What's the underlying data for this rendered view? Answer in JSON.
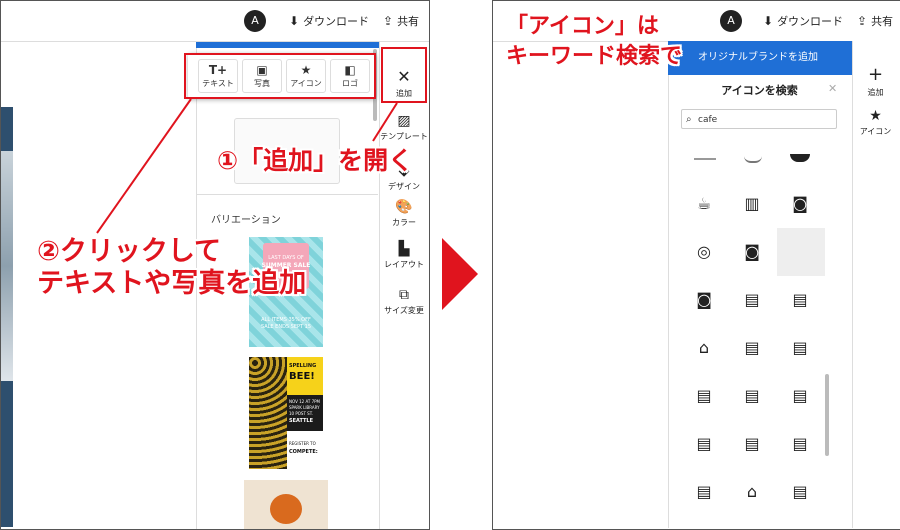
{
  "left": {
    "header": {
      "avatar_initial": "A",
      "download_label": "ダウンロード",
      "share_label": "共有"
    },
    "toolbar_popup": {
      "items": [
        {
          "icon": "T+",
          "label": "テキスト"
        },
        {
          "icon": "▣",
          "label": "写真"
        },
        {
          "icon": "★",
          "label": "アイコン"
        },
        {
          "icon": "◧",
          "label": "ロゴ"
        }
      ]
    },
    "rail": {
      "add_label": "追加",
      "template_label": "テンプレート",
      "design_label": "デザイン",
      "color_label": "カラー",
      "layout_label": "レイアウト",
      "resize_label": "サイズ変更"
    },
    "panel": {
      "section_title": "バリエーション"
    },
    "thumb1": {
      "line1": "LAST DAYS OF",
      "line2": "SUMMER SALE",
      "line3": "ALL ITEMS 35% OFF",
      "line4": "SALE ENDS SEPT 15"
    },
    "thumb2": {
      "line1": "SPELLING",
      "line2": "BEE!",
      "line3": "NOV 12 AT 7PM",
      "line4": "SPARK LIBRARY",
      "line5": "10 POST ST.",
      "line6": "SEATTLE",
      "line7": "REGISTER TO",
      "line8": "COMPETE:"
    },
    "callouts": {
      "c1": "①「追加」を開く",
      "c2_line1": "②クリックして",
      "c2_line2": "テキストや写真を追加"
    }
  },
  "right": {
    "header": {
      "avatar_initial": "A",
      "download_label": "ダウンロード",
      "share_label": "共有"
    },
    "banner": "オリジナルブランドを追加",
    "panel_title": "アイコンを検索",
    "search_value": "cafe",
    "rail": {
      "add_label": "追加",
      "icon_label": "アイコン"
    },
    "callout_line1": "「アイコン」は",
    "callout_line2": "キーワード検索で"
  },
  "colors": {
    "accent": "#e0141e",
    "brand_blue": "#1f6fd6",
    "dark": "#222222"
  },
  "icons": [
    "coffee-cup-icon",
    "coffee-machine-icon",
    "cafe-sign-icon",
    "coffee-latte-icon",
    "cafe-sign-icon",
    "coffee-mug-icon",
    "cafe-sign-icon",
    "storefront-icon",
    "storefront-icon",
    "cafe-building-icon",
    "storefront-icon",
    "storefront-icon",
    "storefront-icon",
    "storefront-icon",
    "storefront-icon",
    "storefront-icon",
    "storefront-icon",
    "storefront-icon",
    "storefront-icon",
    "cafe-building-icon",
    "storefront-icon"
  ]
}
